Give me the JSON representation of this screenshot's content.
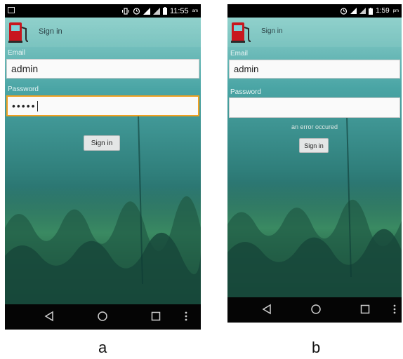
{
  "panels": [
    {
      "id": "a",
      "caption": "a",
      "status_time": "11:55",
      "status_ampm": "am",
      "app_title": "Sign in",
      "email_label": "Email",
      "email_value": "admin",
      "password_label": "Password",
      "password_value": "•••••",
      "signin_label": "Sign in"
    },
    {
      "id": "b",
      "caption": "b",
      "status_time": "1:59",
      "status_ampm": "pm",
      "app_title": "Sign in",
      "email_label": "Email",
      "email_value": "admin",
      "password_label": "Password",
      "password_value": "",
      "error_message": "an error occured",
      "signin_label": "Sign in"
    }
  ],
  "icons": [
    "notification-icon",
    "vibrate-icon",
    "alarm-icon",
    "signal-icon",
    "battery-icon",
    "back-icon",
    "home-icon",
    "recents-icon",
    "overflow-menu-icon",
    "fuel-pump-icon"
  ],
  "colors": {
    "focus_border": "#f0a020",
    "water_top": "#5fb6b4",
    "water_bottom": "#0f3a36"
  }
}
